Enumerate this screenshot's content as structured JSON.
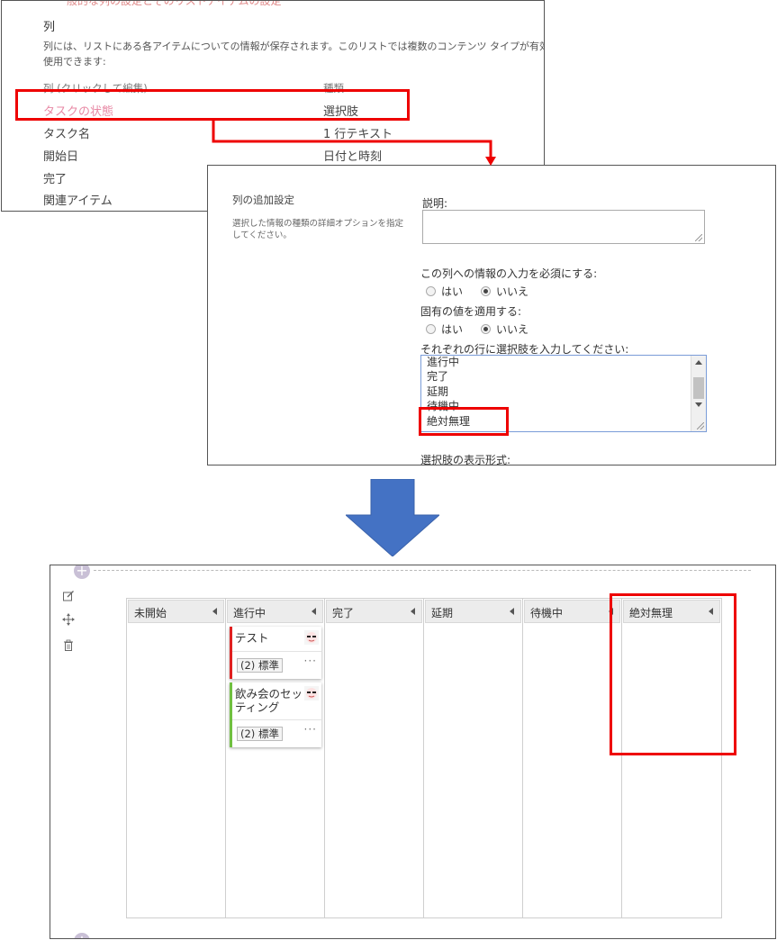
{
  "top_panel": {
    "cut_text": "一般的な列の設定とそのリストアイテムの設定",
    "section_title": "列",
    "description_line1": "列には、リストにある各アイテムについての情報が保存されます。このリストでは複数のコンテンツ タイプが有効なため、アイテム",
    "description_line2": "使用できます:",
    "header_name": "列 (クリックして編集)",
    "header_type": "種類",
    "columns": [
      {
        "name": "タスクの状態",
        "type": "選択肢"
      },
      {
        "name": "タスク名",
        "type": "1 行テキスト"
      },
      {
        "name": "開始日",
        "type": "日付と時刻"
      },
      {
        "name": "完了",
        "type": ""
      },
      {
        "name": "関連アイテム",
        "type": ""
      }
    ]
  },
  "settings_panel": {
    "title": "列の追加設定",
    "description": "選択した情報の種類の詳細オプションを指定してください。",
    "desc_label": "説明:",
    "required_label": "この列への情報の入力を必須にする:",
    "unique_label": "固有の値を適用する:",
    "radio_yes": "はい",
    "radio_no": "いいえ",
    "choices_label": "それぞれの行に選択肢を入力してください:",
    "choices": [
      "進行中",
      "完了",
      "延期",
      "待機中",
      "絶対無理"
    ],
    "display_label": "選択肢の表示形式:"
  },
  "arrow_color": "#4472c4",
  "highlight_color": "#ee0000",
  "board": {
    "columns": [
      {
        "label": "未開始"
      },
      {
        "label": "進行中"
      },
      {
        "label": "完了"
      },
      {
        "label": "延期"
      },
      {
        "label": "待機中"
      },
      {
        "label": "絶対無理"
      }
    ],
    "cards": [
      {
        "title": "テスト",
        "badge": "(2) 標準",
        "more": "···",
        "color": "#e02020"
      },
      {
        "title": "飲み会のセッティング",
        "badge": "(2) 標準",
        "more": "···",
        "color": "#70c040"
      }
    ],
    "tools": [
      "edit-icon",
      "move-icon",
      "delete-icon"
    ]
  }
}
